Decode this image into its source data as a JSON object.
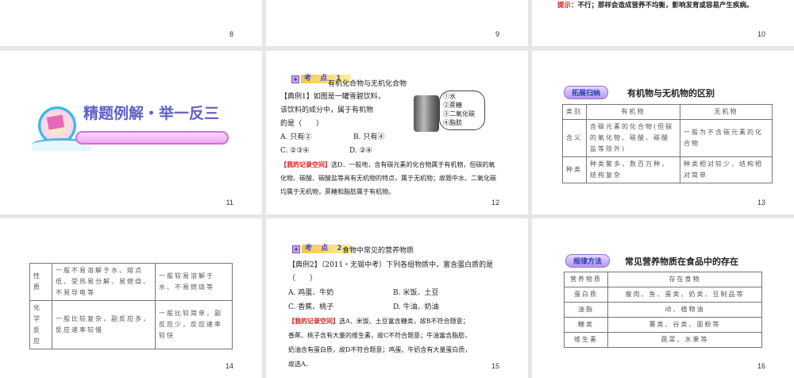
{
  "slides": [
    {
      "number": "8"
    },
    {
      "number": "9"
    },
    {
      "number": "10",
      "hint_label": "提示：",
      "hint_text": "不行；那样会造成营养不均衡，影响发育或容易产生疾病。"
    },
    {
      "number": "11",
      "title": "精题例解・举一反三"
    },
    {
      "number": "12",
      "badge": "考 点 1",
      "topic": "有机化合物与无机化合物",
      "lines": [
        "【典例1】如图是一罐雪碧饮料，",
        "该饮料的成分中，属于有机物",
        "的是（　　）"
      ],
      "options": [
        "A. 只有②",
        "B. 只有④",
        "C. ②③④",
        "D. ②④"
      ],
      "bubble": [
        "①水",
        "②蔗糖",
        "③二氧化碳",
        "④脂肪"
      ],
      "answer_label": "【我的记录空间】",
      "answer": [
        "选D．一般地，含有碳元素的化合物属于有机物，但碳的氧",
        "化物、碳酸、碳酸盐等具有无机物的特点，属于无机物；故题中水、二氧化碳",
        "均属于无机物，蔗糖和脂肪属于有机物。"
      ]
    },
    {
      "number": "13",
      "badge": "拓展归纳",
      "title": "有机物与无机物的区别",
      "table": [
        [
          "类别",
          "有机物",
          "无机物"
        ],
        [
          "含义",
          "含碳元素的化合物(但碳的氧化物、碳酸、碳酸盐等除外)",
          "一般为不含碳元素的化合物"
        ],
        [
          "种类",
          "种类繁多，数百万种，结构复杂",
          "种类相对较少，结构相对简单"
        ]
      ]
    },
    {
      "number": "14",
      "table": [
        [
          "性质",
          "一般不易溶解于水、熔点低、受热易分解、易燃烧、不易导电等",
          "一般较易溶解于水、不易燃烧等"
        ],
        [
          "化学反应",
          "一般比较复杂，副反应多，反应速率较慢",
          "一般比较简单，副反应少，反应速率较快"
        ]
      ]
    },
    {
      "number": "15",
      "badge": "考 点 2",
      "topic": "食物中常见的营养物质",
      "lines": [
        "【典例2】（2011・无锡中考）下列各组物质中，富含蛋白质的是",
        "（　　）"
      ],
      "options": [
        "A. 鸡蛋、牛奶",
        "B. 米饭、土豆",
        "C. 香蕉、桃子",
        "D. 牛油、奶油"
      ],
      "answer_label": "【我的记录空间】",
      "answer": [
        "选A．米饭、土豆富含糖类，故B不符合题意；",
        "香蕉、桃子含有大量的维生素，故C不符合题意；牛油富含脂肪，",
        "奶油含有蛋白质，故D不符合题意；鸡蛋、牛奶含有大量蛋白质，",
        "故选A．"
      ]
    },
    {
      "number": "16",
      "badge": "规律方法",
      "title": "常见营养物质在食品中的存在",
      "table": [
        [
          "营养物质",
          "存在食物"
        ],
        [
          "蛋白质",
          "瘦肉、鱼、蛋类、奶类、豆制品等"
        ],
        [
          "油脂",
          "动、植物油"
        ],
        [
          "糖类",
          "薯类、谷类、面粉等"
        ],
        [
          "维生素",
          "蔬菜、水果等"
        ]
      ]
    }
  ]
}
